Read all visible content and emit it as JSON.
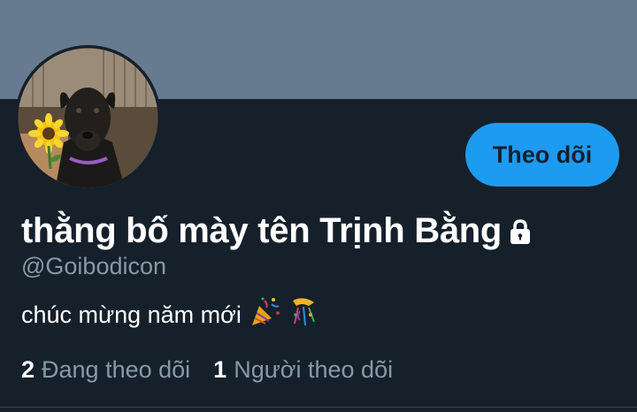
{
  "profile": {
    "display_name": "thằng bố mày tên Trịnh Bằng",
    "handle": "@Goibodicon",
    "bio": "chúc mừng năm mới",
    "bio_emojis": [
      "party-popper-icon",
      "confetti-ball-icon"
    ],
    "protected": true,
    "avatar_icon": "dog-with-sunflower-avatar"
  },
  "actions": {
    "follow_label": "Theo dõi"
  },
  "stats": {
    "following_count": "2",
    "following_label": "Đang theo dõi",
    "followers_count": "1",
    "followers_label": "Người theo dõi"
  },
  "colors": {
    "background": "#15202b",
    "banner": "#667b8f",
    "accent": "#1d9bf0",
    "secondary_text": "#8899a6"
  }
}
